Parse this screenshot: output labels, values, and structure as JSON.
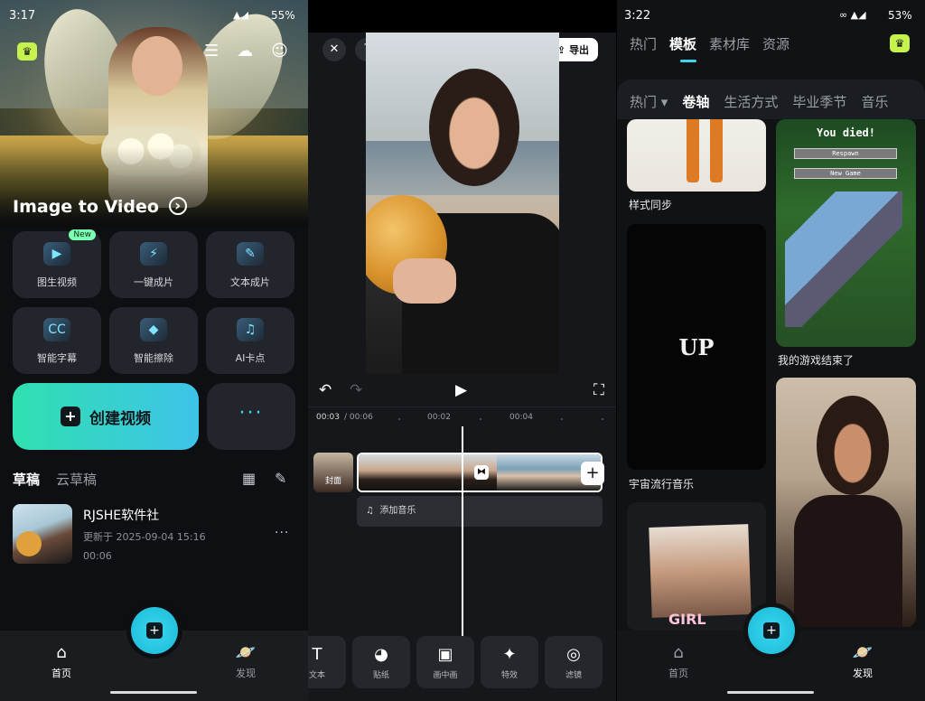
{
  "panel1": {
    "status": {
      "time": "3:17",
      "battery": "55%"
    },
    "crown_glyph": "♛",
    "hero_title": "Image to Video",
    "tiles": [
      {
        "label": "图生视频",
        "icon": "image-to-video-icon",
        "glyph": "▶",
        "badge": "New"
      },
      {
        "label": "一键成片",
        "icon": "one-click-icon",
        "glyph": "⚡"
      },
      {
        "label": "文本成片",
        "icon": "text-to-video-icon",
        "glyph": "✎"
      },
      {
        "label": "智能字幕",
        "icon": "captions-icon",
        "glyph": "CC"
      },
      {
        "label": "智能擦除",
        "icon": "eraser-icon",
        "glyph": "◆"
      },
      {
        "label": "AI卡点",
        "icon": "ai-beat-icon",
        "glyph": "♫"
      }
    ],
    "create_label": "创建视频",
    "more_label": "···",
    "draft_tabs": [
      "草稿",
      "云草稿"
    ],
    "draft": {
      "name": "RJSHE软件社",
      "updated": "更新于 2025-09-04 15:16",
      "duration": "00:06"
    },
    "nav": {
      "home": "首页",
      "discover": "发现"
    }
  },
  "panel2": {
    "export_label": "导出",
    "timecode_current": "00:03",
    "timecode_total": "/ 00:06",
    "ticks": [
      "00:02",
      "00:04"
    ],
    "cover_label": "封面",
    "add_music_label": "添加音乐",
    "tools": [
      {
        "label": "文本",
        "icon": "text-tool-icon",
        "glyph": "T"
      },
      {
        "label": "贴纸",
        "icon": "sticker-icon",
        "glyph": "◕"
      },
      {
        "label": "画中画",
        "icon": "pip-icon",
        "glyph": "▣"
      },
      {
        "label": "特效",
        "icon": "effects-icon",
        "glyph": "✦"
      },
      {
        "label": "滤镜",
        "icon": "filter-icon",
        "glyph": "◎"
      }
    ]
  },
  "panel3": {
    "status": {
      "time": "3:22",
      "battery": "53%"
    },
    "top_tabs": [
      "热门",
      "模板",
      "素材库",
      "资源"
    ],
    "categories": [
      "热门 ▾",
      "卷轴",
      "生活方式",
      "毕业季节",
      "音乐"
    ],
    "cards": {
      "style_sync": "样式同步",
      "cosmic": "宇宙流行音乐",
      "cosmic_text": "UP",
      "game_over": "我的游戏结束了",
      "game_title": "You died!",
      "game_btn1": "Respawn",
      "game_btn2": "New Game",
      "poster_text": "GIRL"
    },
    "nav": {
      "home": "首页",
      "discover": "发现"
    }
  },
  "colors": {
    "accent": "#39d7f0",
    "crown": "#c6f24e",
    "create_gradient_start": "#2fe0b0",
    "create_gradient_end": "#3ec3e8"
  }
}
